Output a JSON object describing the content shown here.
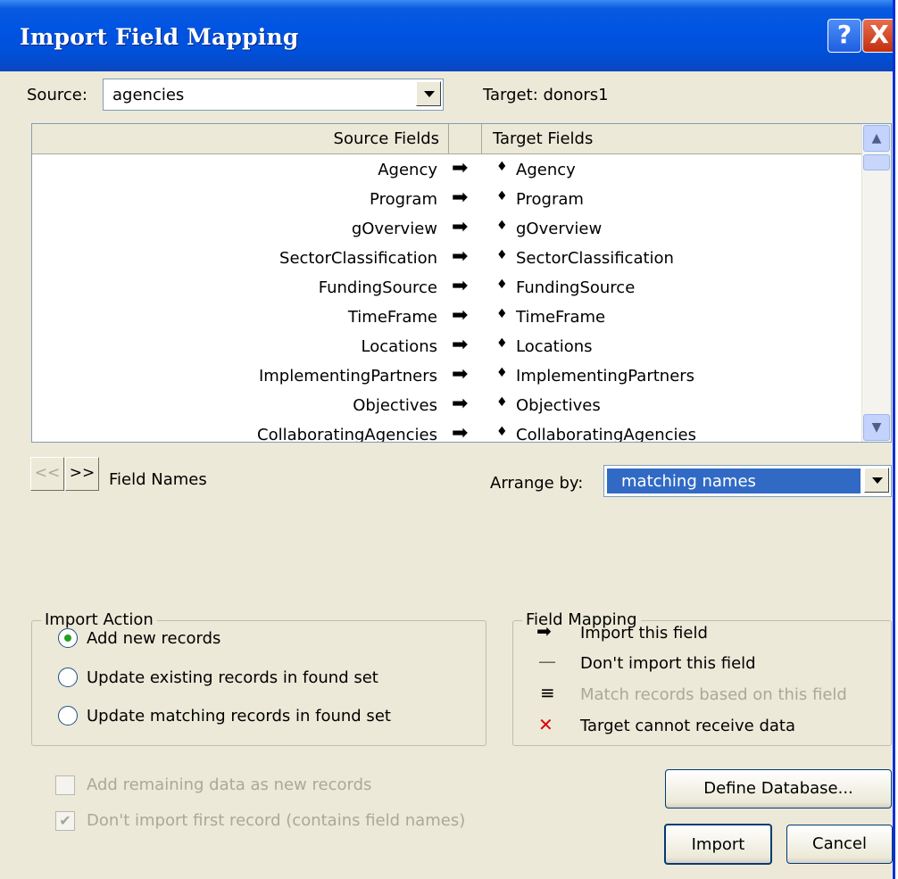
{
  "window": {
    "title": "Import Field Mapping",
    "help": "?",
    "close": "X"
  },
  "source": {
    "label": "Source:",
    "value": "agencies"
  },
  "target": {
    "label": "Target: donors1"
  },
  "grid": {
    "col_source": "Source Fields",
    "col_target": "Target Fields",
    "rows": [
      {
        "source": "Agency",
        "arrow": "➡",
        "mark": "♦",
        "target": "Agency"
      },
      {
        "source": "Program",
        "arrow": "➡",
        "mark": "♦",
        "target": "Program"
      },
      {
        "source": "gOverview",
        "arrow": "➡",
        "mark": "♦",
        "target": "gOverview"
      },
      {
        "source": "SectorClassification",
        "arrow": "➡",
        "mark": "♦",
        "target": "SectorClassification"
      },
      {
        "source": "FundingSource",
        "arrow": "➡",
        "mark": "♦",
        "target": "FundingSource"
      },
      {
        "source": "TimeFrame",
        "arrow": "➡",
        "mark": "♦",
        "target": "TimeFrame"
      },
      {
        "source": "Locations",
        "arrow": "➡",
        "mark": "♦",
        "target": "Locations"
      },
      {
        "source": "ImplementingPartners",
        "arrow": "➡",
        "mark": "♦",
        "target": "ImplementingPartners"
      },
      {
        "source": "Objectives",
        "arrow": "➡",
        "mark": "♦",
        "target": "Objectives"
      },
      {
        "source": "CollaboratingAgencies",
        "arrow": "➡",
        "mark": "♦",
        "target": "CollaboratingAgencies"
      }
    ],
    "scroll_up": "▲",
    "scroll_down": "▼"
  },
  "nav": {
    "prev": "<<",
    "next": ">>",
    "label": "Field Names"
  },
  "arrange": {
    "label": "Arrange by:",
    "value": "matching names"
  },
  "import_action": {
    "title": "Import Action",
    "options": [
      "Add new records",
      "Update existing records in found set",
      "Update matching records in found set"
    ],
    "selected": 0
  },
  "field_mapping": {
    "title": "Field Mapping",
    "items": [
      {
        "icon": "➡",
        "label": "Import this field"
      },
      {
        "icon": "—",
        "label": "Don't import this field"
      },
      {
        "icon": "≡",
        "label": "Match records based on this field"
      },
      {
        "icon": "✕",
        "label": "Target cannot receive data"
      }
    ]
  },
  "options": {
    "add_remaining": {
      "label": "Add remaining data as new records",
      "checked": false
    },
    "dont_import_first": {
      "label": "Don't import first record (contains field names)",
      "checked": true,
      "mark": "✔"
    }
  },
  "buttons": {
    "define": "Define Database...",
    "import": "Import",
    "cancel": "Cancel"
  },
  "colors": {
    "titlebar": "#0054e3",
    "selection": "#316ac5",
    "disabled_text": "#aca899",
    "dialog_bg": "#ece9d8"
  }
}
